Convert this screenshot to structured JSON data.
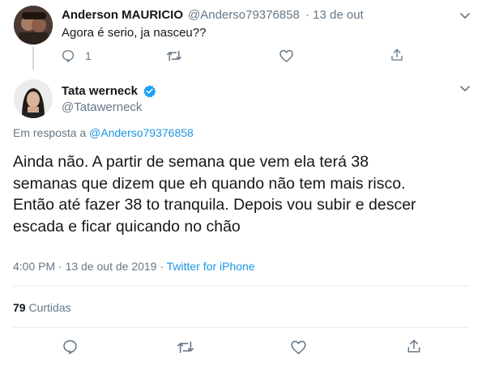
{
  "parent_tweet": {
    "author_name": "Anderson MAURICIO",
    "author_handle": "@Anderso79376858",
    "date": "· 13 de out",
    "text": "Agora é serio, ja nasceu??",
    "reply_count": "1",
    "icons": [
      "reply-icon",
      "retweet-icon",
      "like-icon",
      "share-icon"
    ]
  },
  "main_tweet": {
    "author_name": "Tata werneck",
    "verified": true,
    "author_handle": "@Tatawerneck",
    "reply_to_prefix": "Em resposta a",
    "reply_to_handle": "@Anderso79376858",
    "text_lines": [
      "Ainda não. A partir de semana que vem ela terá 38",
      "semanas que dizem que eh quando não tem mais risco.",
      "Então até fazer 38 to tranquila. Depois vou subir e descer",
      "escada e ficar quicando no chão"
    ],
    "timestamp": "4:00 PM · 13 de out de 2019 ·",
    "source": "Twitter for iPhone",
    "likes_count": "79",
    "likes_label": "Curtidas",
    "icons": [
      "reply-icon",
      "retweet-icon",
      "like-icon",
      "share-icon"
    ]
  },
  "colors": {
    "link": "#1b95e0",
    "secondary_text": "#657786",
    "verified": "#1da1f2",
    "divider": "#e6ecf0"
  }
}
